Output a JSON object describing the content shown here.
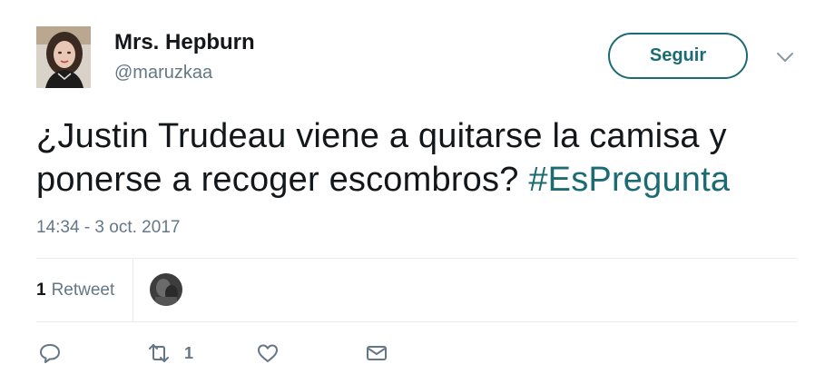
{
  "author": {
    "display_name": "Mrs. Hepburn",
    "username": "@maruzkaa"
  },
  "follow_button_label": "Seguir",
  "tweet": {
    "text_main": "¿Justin Trudeau viene a quitarse la camisa y ponerse a recoger escombros? ",
    "hashtag": "#EsPregunta",
    "timestamp": "14:34 - 3 oct. 2017"
  },
  "stats": {
    "retweet_count": "1",
    "retweet_label": "Retweet"
  },
  "actions": {
    "reply_icon": "reply-icon",
    "retweet_icon": "retweet-icon",
    "retweet_count": "1",
    "like_icon": "heart-icon",
    "message_icon": "envelope-icon"
  },
  "colors": {
    "accent": "#1b6b72",
    "secondary_text": "#657786",
    "primary_text": "#14171a",
    "divider": "#e6ecf0"
  }
}
